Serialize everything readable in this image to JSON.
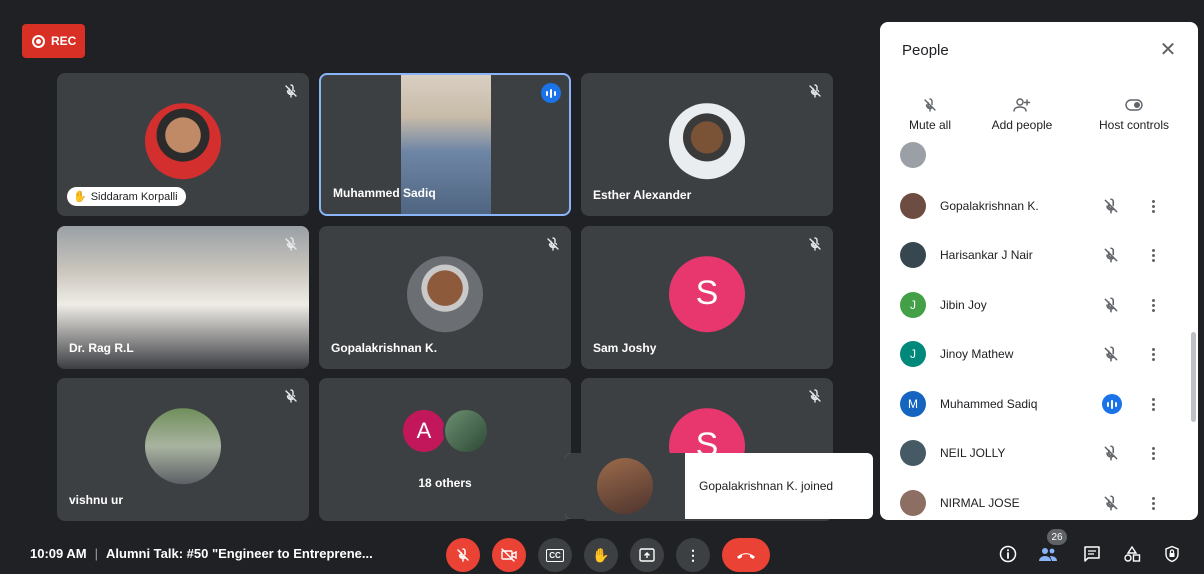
{
  "recording": {
    "label": "REC",
    "color": "#d93025"
  },
  "tiles": [
    {
      "name": "Siddaram Korpalli",
      "muted": true,
      "kind": "photo",
      "pill": true
    },
    {
      "name": "Muhammed Sadiq",
      "muted": false,
      "kind": "video",
      "speaking": true
    },
    {
      "name": "Esther Alexander",
      "muted": true,
      "kind": "photo"
    },
    {
      "name": "Dr. Rag R.L",
      "muted": true,
      "kind": "video"
    },
    {
      "name": "Gopalakrishnan K.",
      "muted": true,
      "kind": "photo"
    },
    {
      "name": "Sam Joshy",
      "muted": true,
      "kind": "letter",
      "letter": "S",
      "color": "#e8366f"
    },
    {
      "name": "vishnu ur",
      "muted": true,
      "kind": "photo"
    },
    {
      "name": "18 others",
      "kind": "group",
      "letter": "A"
    },
    {
      "name": "",
      "muted": true,
      "kind": "letter",
      "letter": "S",
      "color": "#e8366f"
    }
  ],
  "toast": {
    "message": "Gopalakrishnan K. joined"
  },
  "bottom_bar": {
    "time": "10:09 AM",
    "meeting_title": "Alumni Talk: #50 \"Engineer to Entreprene...",
    "participant_count": "26"
  },
  "people_panel": {
    "title": "People",
    "actions": [
      {
        "label": "Mute all",
        "icon": "mic-off-icon"
      },
      {
        "label": "Add people",
        "icon": "add-person-icon"
      },
      {
        "label": "Host controls",
        "icon": "toggle-icon"
      }
    ],
    "participants": [
      {
        "name": "Gopalakrishnan K.",
        "avatar": "photo",
        "color": "#6d4c41",
        "state": "muted"
      },
      {
        "name": "Harisankar J Nair",
        "avatar": "photo",
        "color": "#37474f",
        "state": "muted"
      },
      {
        "name": "Jibin Joy",
        "avatar": "J",
        "color": "#43a047",
        "state": "muted"
      },
      {
        "name": "Jinoy Mathew",
        "avatar": "J",
        "color": "#00897b",
        "state": "muted"
      },
      {
        "name": "Muhammed Sadiq",
        "avatar": "M",
        "color": "#1565c0",
        "state": "speaking"
      },
      {
        "name": "NEIL JOLLY",
        "avatar": "photo",
        "color": "#455a64",
        "state": "muted"
      },
      {
        "name": "NIRMAL JOSE",
        "avatar": "photo",
        "color": "#8d6e63",
        "state": "muted"
      }
    ]
  }
}
